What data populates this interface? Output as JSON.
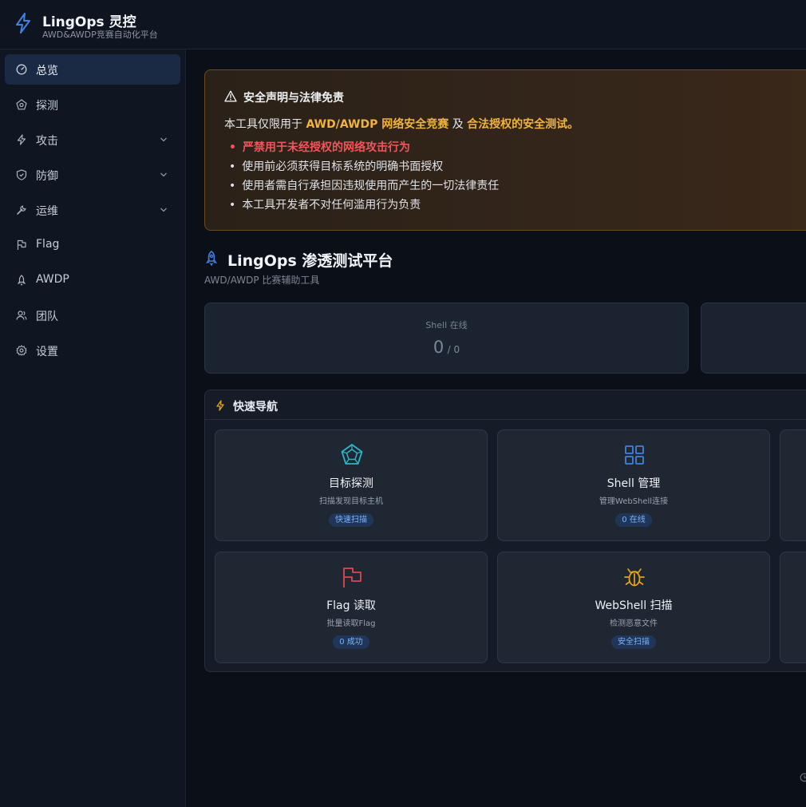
{
  "app": {
    "title": "LingOps 灵控",
    "subtitle": "AWD&AWDP竞赛自动化平台"
  },
  "sidebar": {
    "items": [
      {
        "label": "总览",
        "icon": "dashboard-icon",
        "active": true
      },
      {
        "label": "探测",
        "icon": "radar-icon"
      },
      {
        "label": "攻击",
        "icon": "bolt-icon",
        "expandable": true
      },
      {
        "label": "防御",
        "icon": "shield-icon",
        "expandable": true
      },
      {
        "label": "运维",
        "icon": "wrench-icon",
        "expandable": true
      },
      {
        "label": "Flag",
        "icon": "flag-icon"
      },
      {
        "label": "AWDP",
        "icon": "rocket-icon"
      },
      {
        "label": "团队",
        "icon": "team-icon"
      },
      {
        "label": "设置",
        "icon": "gear-icon"
      }
    ]
  },
  "notice": {
    "title": "安全声明与法律免责",
    "intro_prefix": "本工具仅限用于 ",
    "intro_hl1": "AWD/AWDP 网络安全竞赛",
    "intro_mid": " 及 ",
    "intro_hl2": "合法授权的安全测试。",
    "items": [
      "严禁用于未经授权的网络攻击行为",
      "使用前必须获得目标系统的明确书面授权",
      "使用者需自行承担因违规使用而产生的一切法律责任",
      "本工具开发者不对任何滥用行为负责"
    ]
  },
  "page": {
    "title": "LingOps 渗透测试平台",
    "subtitle": "AWD/AWDP 比赛辅助工具"
  },
  "stats": [
    {
      "label": "Shell 在线",
      "value": "0",
      "total": "/ 0"
    }
  ],
  "quick_nav": {
    "title": "快速导航",
    "cards": [
      {
        "title": "目标探测",
        "desc": "扫描发现目标主机",
        "badge": "快速扫描",
        "icon": "pentagon-radar-icon",
        "color": "#2bb6c9"
      },
      {
        "title": "Shell 管理",
        "desc": "管理WebShell连接",
        "badge": "0 在线",
        "icon": "grid-icon",
        "color": "#3f82e0"
      },
      {
        "title": "Flag 读取",
        "desc": "批量读取Flag",
        "badge": "0 成功",
        "icon": "flag-icon",
        "color": "#e0474f"
      },
      {
        "title": "WebShell 扫描",
        "desc": "检测恶意文件",
        "badge": "安全扫描",
        "icon": "bug-icon",
        "color": "#e8a21f"
      }
    ]
  },
  "colors": {
    "accent": "#3f82e0",
    "warning": "#f2b33d",
    "danger": "#f2545b"
  }
}
